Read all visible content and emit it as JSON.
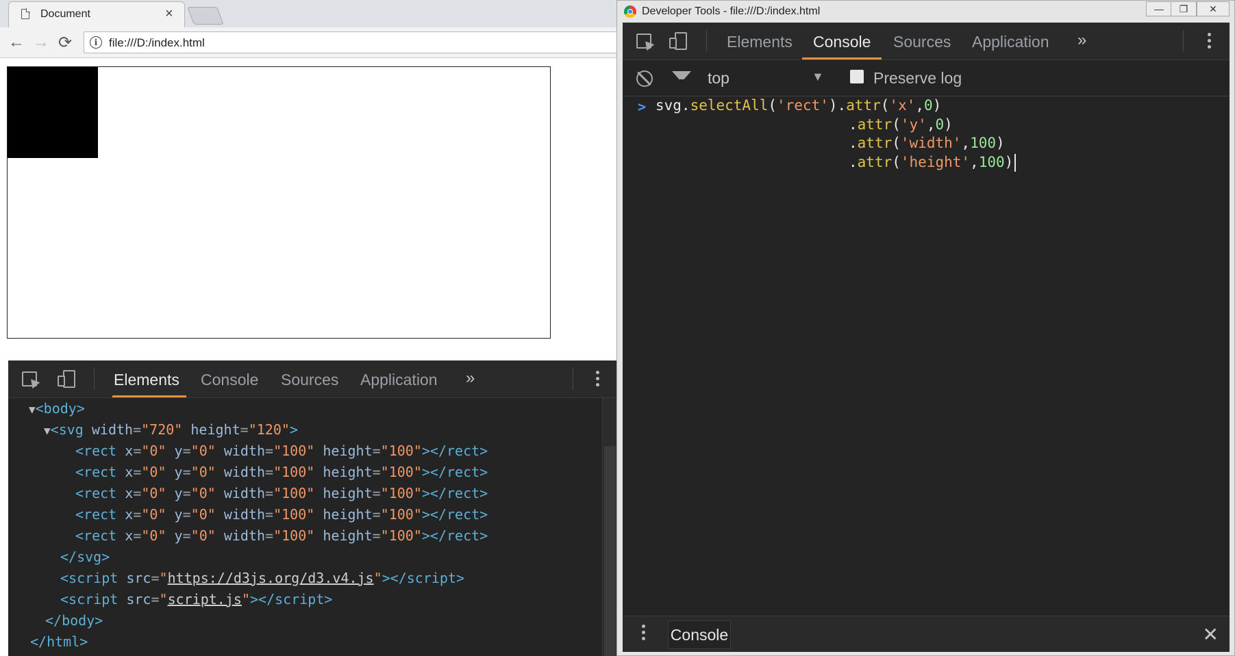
{
  "browser": {
    "tab_title": "Document",
    "tab_close": "×",
    "back": "←",
    "forward": "→",
    "reload": "⟳",
    "info": "i",
    "url": "file:///D:/index.html"
  },
  "docked_devtools": {
    "tabs": [
      "Elements",
      "Console",
      "Sources",
      "Application"
    ],
    "active_tab": "Elements",
    "more": "»",
    "dom": {
      "body_open": "<body>",
      "svg_tag": "svg",
      "svg_width": "720",
      "svg_height": "120",
      "rect_x": "0",
      "rect_y": "0",
      "rect_width": "100",
      "rect_height": "100",
      "svg_close": "</svg>",
      "script1_src": "https://d3js.org/d3.v4.js",
      "script2_src": "script.js",
      "body_close": "</body>",
      "html_close": "</html>"
    }
  },
  "devtools_window": {
    "title": "Developer Tools - file:///D:/index.html",
    "minimize": "—",
    "restore": "❐",
    "close": "✕",
    "tabs": [
      "Elements",
      "Console",
      "Sources",
      "Application"
    ],
    "active_tab": "Console",
    "more": "»",
    "context": "top",
    "context_arrow": "▼",
    "preserve_log": "Preserve log",
    "prompt": ">",
    "code": {
      "l1_obj": "svg.",
      "l1_fn": "selectAll",
      "l1_p1": "(",
      "l1_str": "'rect'",
      "l1_p2": ").",
      "fn_attr": "attr",
      "str_x": "'x'",
      "str_y": "'y'",
      "str_width": "'width'",
      "str_height": "'height'",
      "num_0": "0",
      "num_100": "100"
    },
    "drawer_tab": "Console",
    "drawer_close": "✕"
  }
}
